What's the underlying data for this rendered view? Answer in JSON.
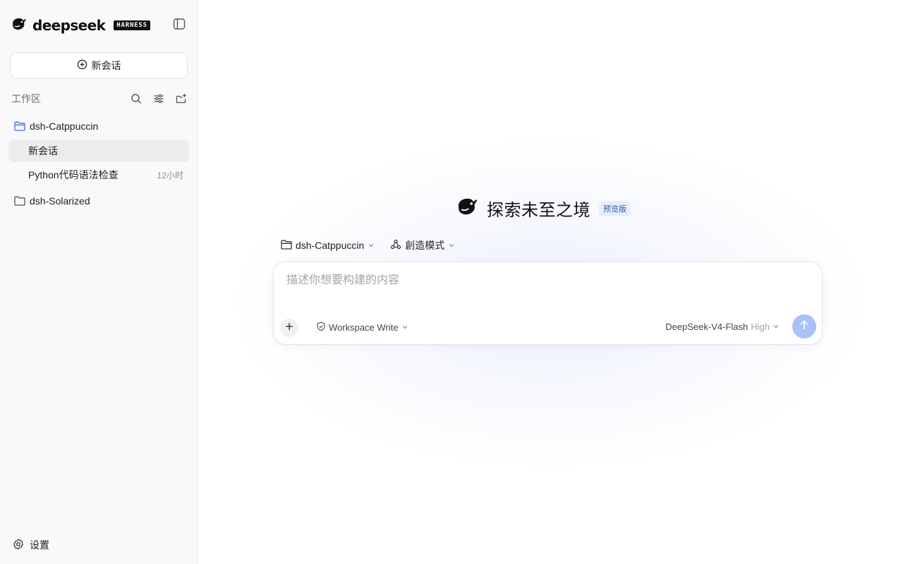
{
  "brand": {
    "wordmark": "deepseek",
    "badge": "HARNESS",
    "logo_icon": "whale-icon"
  },
  "sidebar": {
    "toggle_icon": "sidebar-toggle-icon",
    "new_chat": {
      "label": "新会话",
      "icon": "plus-circle-icon"
    },
    "workspace": {
      "title": "工作区",
      "tools": [
        "search-icon",
        "filter-icon",
        "new-folder-icon"
      ]
    },
    "folders": [
      {
        "name": "dsh-Catppuccin",
        "icon": "folder-open-icon",
        "sessions": [
          {
            "label": "新会话",
            "time": "",
            "active": true
          },
          {
            "label": "Python代码语法检查",
            "time": "12小时",
            "active": false
          }
        ]
      },
      {
        "name": "dsh-Solarized",
        "icon": "folder-icon",
        "sessions": []
      }
    ],
    "settings_label": "设置"
  },
  "main": {
    "hero_title": "探索未至之境",
    "hero_badge": "预览版",
    "context": {
      "project": "dsh-Catppuccin",
      "mode": "創造模式"
    },
    "composer": {
      "placeholder": "描述你想要构建的内容",
      "value": "",
      "permission": "Workspace Write",
      "model": "DeepSeek-V4-Flash",
      "effort": "High"
    }
  },
  "colors": {
    "accent_send": "#a9c1f5",
    "folder_active": "#3d6fe0",
    "badge_bg": "#e6eefc"
  }
}
